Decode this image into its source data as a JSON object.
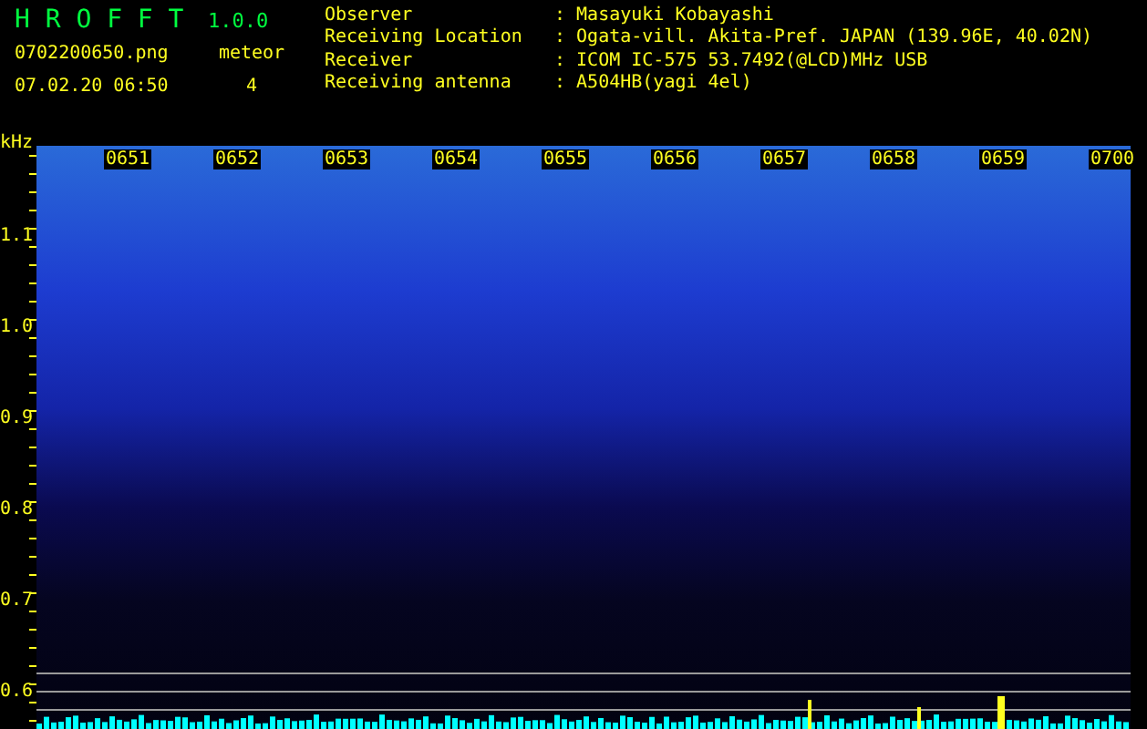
{
  "app": {
    "title": "H R O F F T",
    "version": "1.0.0",
    "filename": "0702200650.png",
    "datetime": "07.02.20 06:50",
    "meteor_label": "meteor",
    "meteor_count": "4"
  },
  "info": [
    {
      "label": "Observer",
      "value": ": Masayuki Kobayashi"
    },
    {
      "label": "Receiving Location",
      "value": ": Ogata-vill. Akita-Pref. JAPAN (139.96E, 40.02N)"
    },
    {
      "label": "Receiver",
      "value": ": ICOM IC-575 53.7492(@LCD)MHz USB"
    },
    {
      "label": "Receiving antenna",
      "value": ": A504HB(yagi 4el)"
    }
  ],
  "axis": {
    "unit": "kHz",
    "y_labels": [
      "1.1",
      "1.0",
      "0.9",
      "0.8",
      "0.7",
      "0.6"
    ],
    "time_labels": [
      "0651",
      "0652",
      "0653",
      "0654",
      "0655",
      "0656",
      "0657",
      "0658",
      "0659",
      "0700"
    ]
  }
}
